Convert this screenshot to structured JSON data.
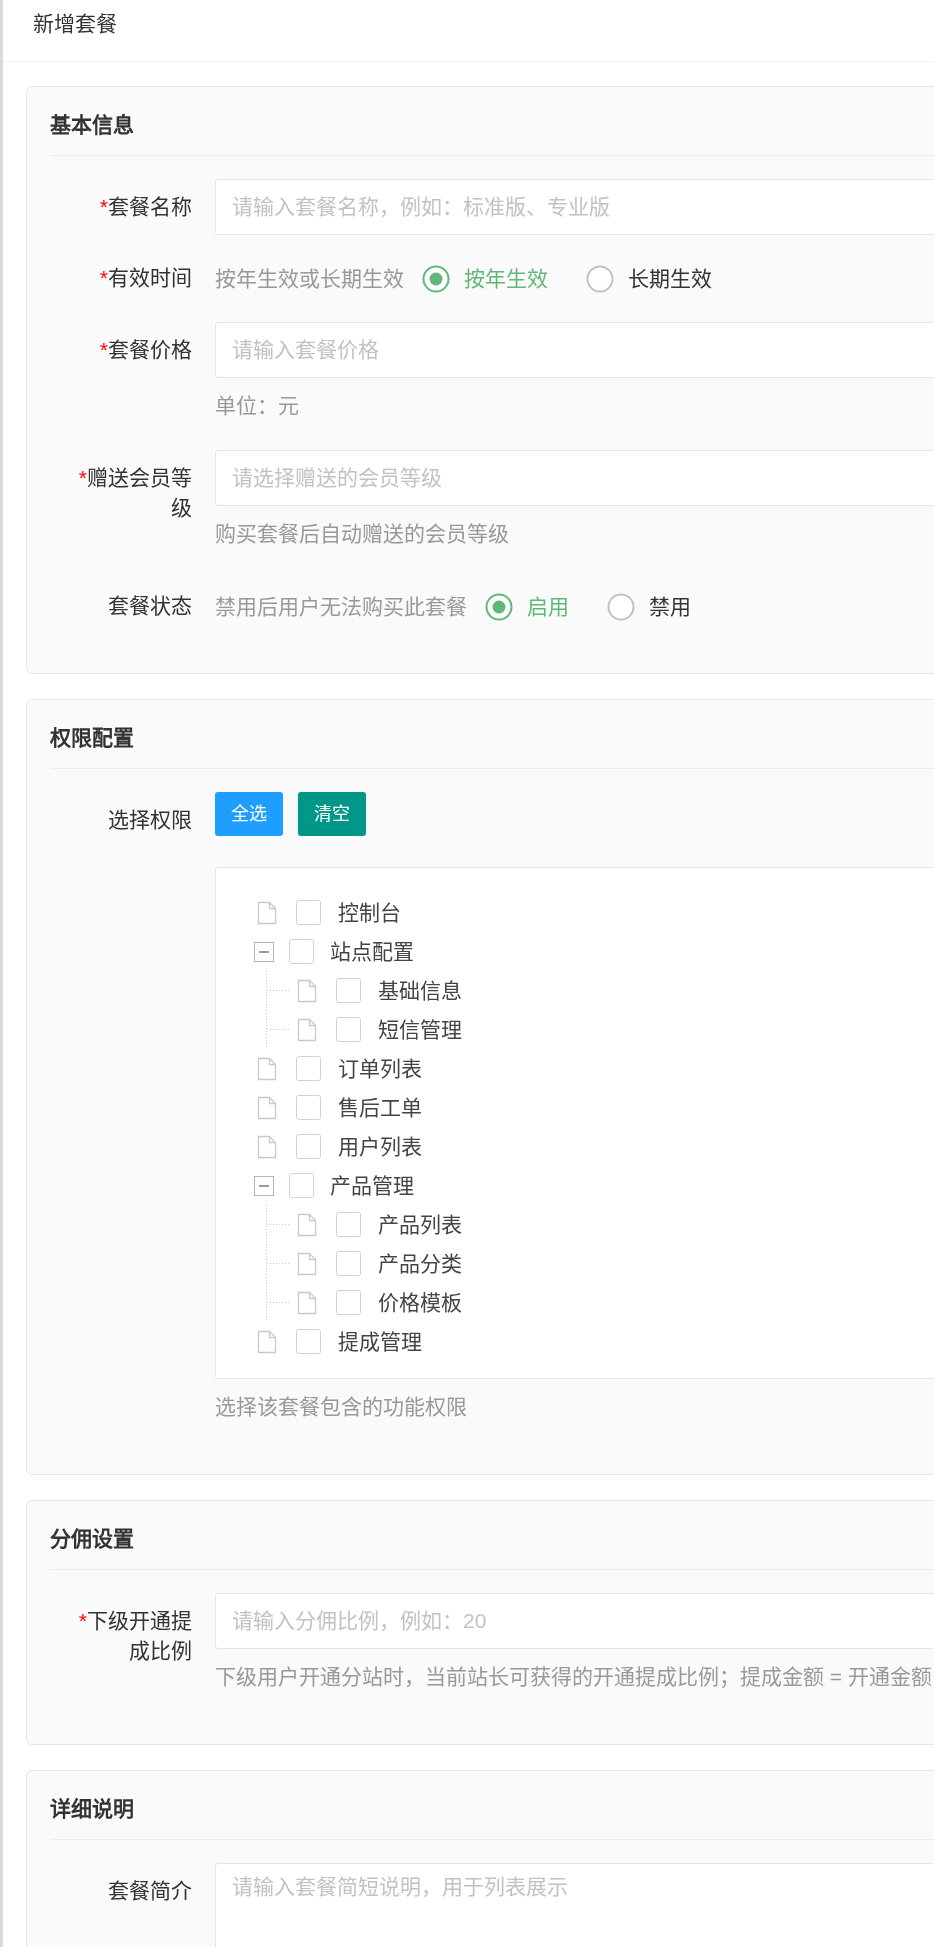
{
  "header": {
    "title": "新增套餐"
  },
  "sections": [
    {
      "title": "基本信息",
      "fields": [
        {
          "kind": "input",
          "required_mark": "*",
          "label": "套餐名称",
          "placeholder": "请输入套餐名称，例如：标准版、专业版"
        },
        {
          "kind": "radio",
          "required_mark": "*",
          "label": "有效时间",
          "hint": "按年生效或长期生效",
          "options": [
            {
              "label": "按年生效",
              "selected": true
            },
            {
              "label": "长期生效",
              "selected": false
            }
          ]
        },
        {
          "kind": "input",
          "required_mark": "*",
          "label": "套餐价格",
          "placeholder": "请输入套餐价格",
          "help": "单位：元"
        },
        {
          "kind": "input",
          "required_mark": "*",
          "label": "赠送会员等级",
          "placeholder": "请选择赠送的会员等级",
          "help": "购买套餐后自动赠送的会员等级"
        },
        {
          "kind": "radio",
          "label": "套餐状态",
          "hint": "禁用后用户无法购买此套餐",
          "options": [
            {
              "label": "启用",
              "selected": true
            },
            {
              "label": "禁用",
              "selected": false
            }
          ]
        }
      ]
    },
    {
      "title": "权限配置",
      "fields": [
        {
          "kind": "tree",
          "label": "选择权限",
          "buttons": [
            {
              "label": "全选",
              "color": "#1e9fff"
            },
            {
              "label": "清空",
              "color": "#009688"
            }
          ],
          "tree": [
            {
              "kind": "leaf",
              "label": "控制台",
              "checked": false
            },
            {
              "kind": "group",
              "label": "站点配置",
              "checked": false,
              "expanded": true,
              "children": [
                {
                  "kind": "leaf",
                  "label": "基础信息",
                  "checked": false
                },
                {
                  "kind": "leaf",
                  "label": "短信管理",
                  "checked": false
                }
              ]
            },
            {
              "kind": "leaf",
              "label": "订单列表",
              "checked": false
            },
            {
              "kind": "leaf",
              "label": "售后工单",
              "checked": false
            },
            {
              "kind": "leaf",
              "label": "用户列表",
              "checked": false
            },
            {
              "kind": "group",
              "label": "产品管理",
              "checked": false,
              "expanded": true,
              "children": [
                {
                  "kind": "leaf",
                  "label": "产品列表",
                  "checked": false
                },
                {
                  "kind": "leaf",
                  "label": "产品分类",
                  "checked": false
                },
                {
                  "kind": "leaf",
                  "label": "价格模板",
                  "checked": false
                }
              ]
            },
            {
              "kind": "leaf",
              "label": "提成管理",
              "checked": false
            }
          ],
          "help": "选择该套餐包含的功能权限"
        }
      ]
    },
    {
      "title": "分佣设置",
      "fields": [
        {
          "kind": "input",
          "required_mark": "*",
          "label": "下级开通提成比例",
          "placeholder": "请输入分佣比例，例如：20",
          "help": "下级用户开通分站时，当前站长可获得的开通提成比例；提成金额 = 开通金额"
        }
      ]
    },
    {
      "title": "详细说明",
      "fields": [
        {
          "kind": "textarea",
          "label": "套餐简介",
          "placeholder": "请输入套餐简短说明，用于列表展示"
        }
      ]
    }
  ]
}
